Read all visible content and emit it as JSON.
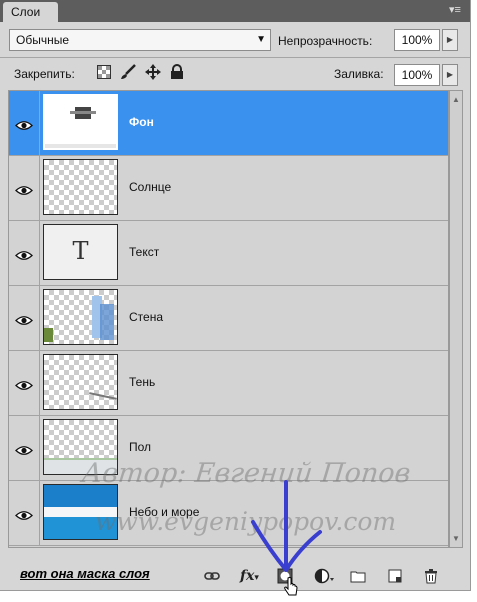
{
  "panel": {
    "tab_label": "Слои",
    "menu_glyph": "▾≡"
  },
  "toolbar": {
    "blend_mode": "Обычные",
    "opacity_label": "Непрозрачность:",
    "opacity_value": "100%",
    "lock_label": "Закрепить:",
    "fill_label": "Заливка:",
    "fill_value": "100%"
  },
  "layers": [
    {
      "name": "Фон",
      "selected": true,
      "thumb": "photo"
    },
    {
      "name": "Солнце",
      "selected": false,
      "thumb": "transparent"
    },
    {
      "name": "Текст",
      "selected": false,
      "thumb": "text",
      "glyph": "T"
    },
    {
      "name": "Стена",
      "selected": false,
      "thumb": "wall"
    },
    {
      "name": "Тень",
      "selected": false,
      "thumb": "shadow"
    },
    {
      "name": "Пол",
      "selected": false,
      "thumb": "floor"
    },
    {
      "name": "Небо и море",
      "selected": false,
      "thumb": "sky"
    }
  ],
  "annotation": {
    "caption": "вот она маска слоя",
    "arrow_color": "#3a3fd0"
  },
  "watermark": {
    "line1": "Автор:  Евгений  Попов",
    "line2": "www.evgeniypopov.com"
  },
  "colors": {
    "selection": "#3a92ee",
    "panel_bg": "#d6d6d6",
    "tab_bar": "#5d5d5d"
  }
}
